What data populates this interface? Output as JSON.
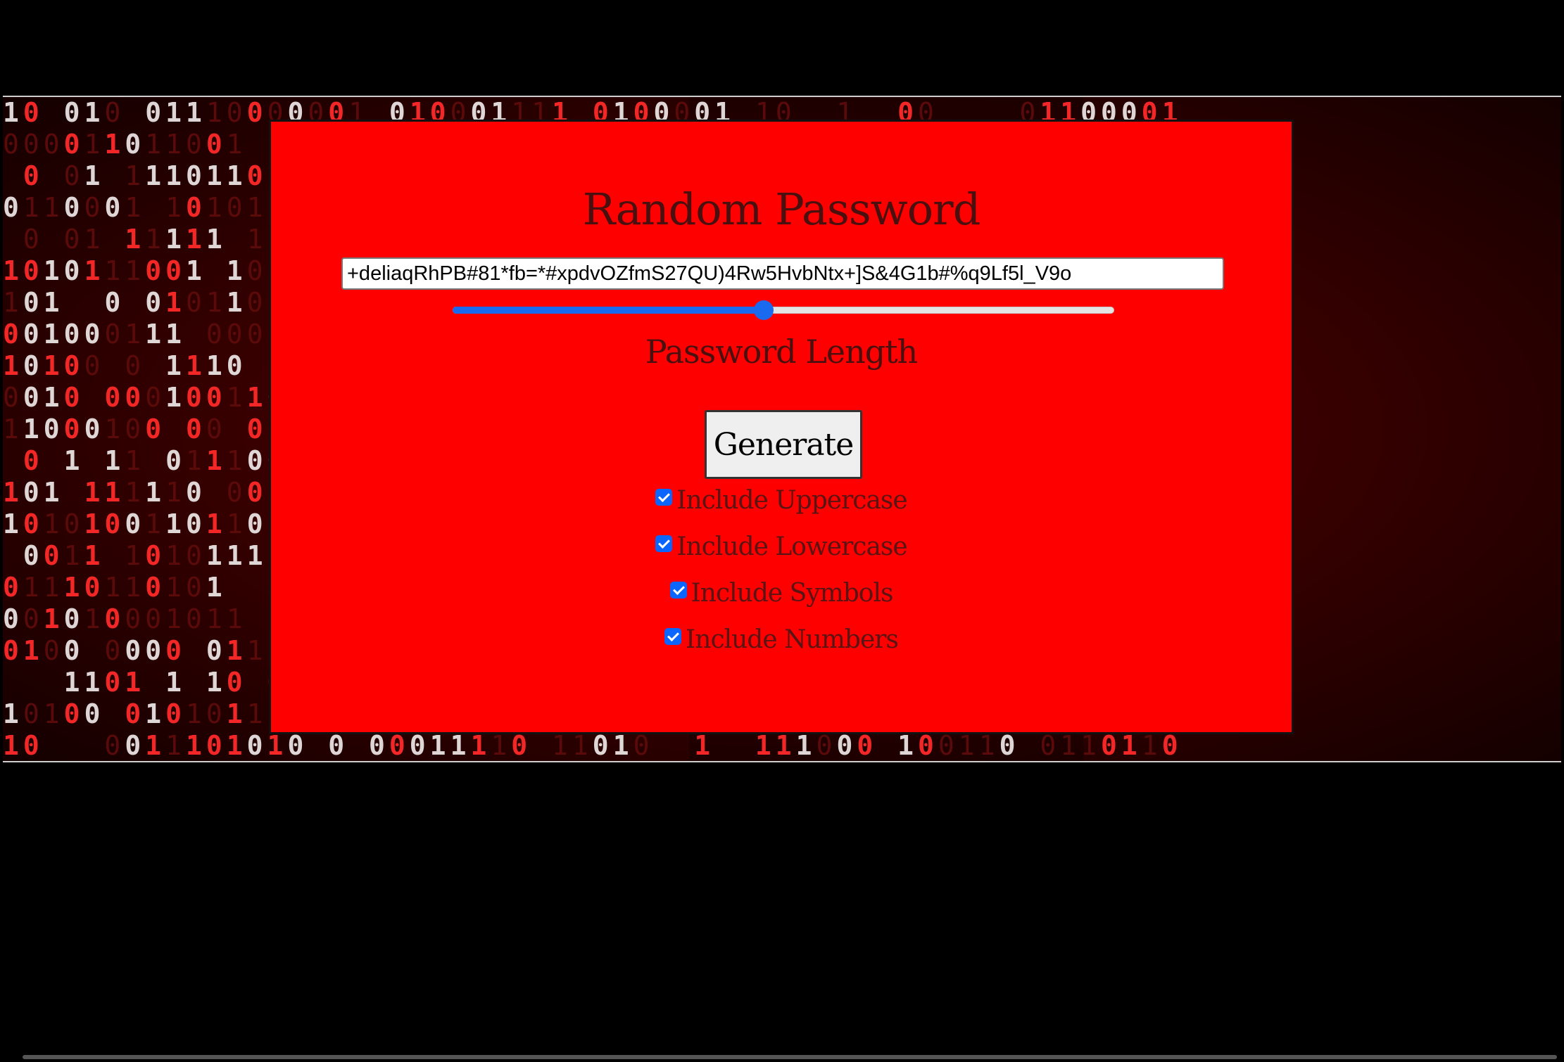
{
  "app": {
    "title": "Random Password",
    "password_value": "+deliaqRhPB#81*fb=*#xpdvOZfmS27QU)4Rw5HvbNtx+]S&4G1b#%q9Lf5l_V9o",
    "length_label": "Password Length",
    "length_slider_fraction": 0.47,
    "generate_label": "Generate",
    "options": [
      {
        "label": "Include Uppercase",
        "checked": true
      },
      {
        "label": "Include Lowercase",
        "checked": true
      },
      {
        "label": "Include Symbols",
        "checked": true
      },
      {
        "label": "Include Numbers",
        "checked": true
      }
    ]
  },
  "colors": {
    "card_background": "#ff0000",
    "accent": "#1a6af0",
    "page_background": "#000000"
  },
  "icons": {
    "background": "binary-matrix-background",
    "checkbox": "checkmark-icon"
  }
}
